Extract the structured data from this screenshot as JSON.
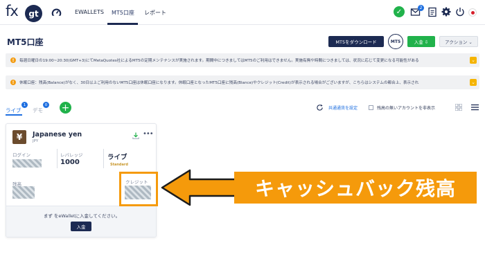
{
  "header": {
    "logo_fx": "fx",
    "logo_gt": "gt",
    "nav": [
      {
        "label": "EWALLETS"
      },
      {
        "label": "MT5口座"
      },
      {
        "label": "レポート"
      }
    ],
    "mail_badge": "2",
    "icons": [
      "dashboard-icon",
      "check-icon",
      "mail-icon",
      "clipboard-icon",
      "gear-icon",
      "power-icon",
      "japan-flag-icon"
    ]
  },
  "title_row": {
    "title": "MT5口座",
    "download_label": "MT5をダウンロード",
    "mt5_badge": "MT5",
    "deposit_label": "入金 ⇩",
    "action_label": "アクション ⌄"
  },
  "notices": [
    {
      "text": "毎週日曜日の19:00~20:30(GMT+3)にてMetaQuotes社によるMT5の定期メンテナンスが実施されます。期間中につきましてはMT5のご利用はできません。実施有無や時間につきましては、状況に応じて変更になる可能性がある"
    },
    {
      "text": "休眠口座：残高(Balance)がなく、30日以上ご利用のないMT5口座は休眠口座になります。休眠口座となったMT5口座に残高(Blance)やクレジット(Credit)が表示される場合がございますが、こちらはシステムの都合上、表示され"
    }
  ],
  "tabs": {
    "live": "ライブ",
    "live_count": "1",
    "demo": "デモ",
    "demo_count": "0",
    "add": "+"
  },
  "toolbar": {
    "common_currency": "共通通貨を設定",
    "hide_no_balance": "残高の無いアカウントを非表示"
  },
  "card": {
    "currency_symbol": "¥",
    "currency_name": "Japanese yen",
    "currency_code": "JPY",
    "more": "•••",
    "login_label": "ログイン",
    "leverage_label": "レバレッジ",
    "leverage_value": "1000",
    "type_label": "ライブ",
    "type_sub": "Standard",
    "balance_label": "残高",
    "credit_label": "クレジット",
    "footer_text": "まず をeWalletに入金してください。",
    "footer_button": "入金"
  },
  "annotation": {
    "text": "キャッシュバック残高",
    "color": "#f59a0b"
  },
  "colors": {
    "navy": "#1c2a52",
    "green": "#21b24b",
    "blue": "#1e6fe0",
    "warning": "#f39c12"
  }
}
